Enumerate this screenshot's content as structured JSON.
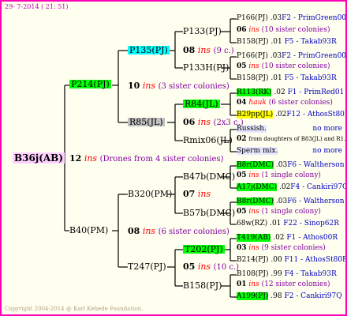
{
  "header_date": "29-  7-2014 ( 21: 51)",
  "footer": "Copyright 2004-2014 @ Karl Kehede Foundation.",
  "root": {
    "name": "B36j(AB)",
    "gen": "12",
    "ins": "ins",
    "note": "(Drones from 4 sister colonies)"
  },
  "sire_side": {
    "name": "P214(PJ)",
    "gen": "10",
    "ins": "ins",
    "note": "(3 sister colonies)",
    "sire": {
      "name": "P135(PJ)",
      "gen": "08",
      "ins": "ins",
      "note": "(9 c.)",
      "sire": {
        "name": "P133(PJ)",
        "gen": "06",
        "ins": "ins",
        "note": "(10 sister colonies)"
      },
      "dam": {
        "name": "P133H(PJ)",
        "gen": "05",
        "ins": "ins",
        "note": "(10 sister colonies)"
      }
    },
    "dam": {
      "name": "R85(JL)",
      "gen": "06",
      "ins": "ins",
      "note": "(2x3 c.)",
      "sire": {
        "name": "R84(JL)",
        "gen": "04",
        "ins": "hauk",
        "note": "(6 sister colonies)"
      },
      "dam": {
        "name": "Rmix06(JL)",
        "gen": "02",
        "ins": "",
        "note": "from daughters of B83(JL) and R1..."
      }
    }
  },
  "dam_side": {
    "name": "B40(PM)",
    "gen": "08",
    "ins": "ins",
    "note": "(6 sister colonies)",
    "sire": {
      "name": "B320(PM)",
      "gen": "07",
      "ins": "ins",
      "note": "",
      "sire": {
        "name": "B47b(DMC)",
        "gen": "05",
        "ins": "ins",
        "note": "(1 single colony)"
      },
      "dam": {
        "name": "B57b(DMC)",
        "gen": "05",
        "ins": "ins",
        "note": "(1 single colony)"
      }
    },
    "dam": {
      "name": "T247(PJ)",
      "gen": "05",
      "ins": "ins",
      "note": "(10 c.)",
      "sire": {
        "name": "T202(PJ)",
        "gen": "03",
        "ins": "ins",
        "note": "(9 sister colonies)"
      },
      "dam": {
        "name": "B158(PJ)",
        "gen": "01",
        "ins": "ins",
        "note": "(12 sister colonies)"
      }
    }
  },
  "col4": [
    {
      "a": "P166(PJ)",
      "b": ".03",
      "c": "F2 - PrimGreen00"
    },
    {
      "a": "B158(PJ)",
      "b": ".01",
      "c": "F5 - Takab93R"
    },
    {
      "a": "P166(PJ)",
      "b": ".03",
      "c": "F2 - PrimGreen00"
    },
    {
      "a": "B158(PJ)",
      "b": ".01",
      "c": "F5 - Takab93R"
    },
    {
      "a": "R113(RK)",
      "b": ".02",
      "c": "F1 - PrimRed01"
    },
    {
      "a": "B29pp(JL)",
      "b": ".02",
      "c": "F12 - AthosSt80R"
    },
    {
      "a": "Russish.",
      "b": "",
      "c": "no more"
    },
    {
      "a": "Sperm mix.",
      "b": "",
      "c": "no more"
    },
    {
      "a": "B8r(DMC)",
      "b": ".03",
      "c": "F6 - Waltherson"
    },
    {
      "a": "A17j(DMC)",
      "b": ".02",
      "c": "F4 - Cankiri97Q"
    },
    {
      "a": "B8r(DMC)",
      "b": ".03",
      "c": "F6 - Waltherson"
    },
    {
      "a": "68w(RZ)",
      "b": ".01",
      "c": "F22 - Sinop62R"
    },
    {
      "a": "T419(AB)",
      "b": ".02",
      "c": "F1 - Athos00R"
    },
    {
      "a": "B214(PJ)",
      "b": ".00",
      "c": "F11 - AthosSt80R"
    },
    {
      "a": "B108(PJ)",
      "b": ".99",
      "c": "F4 - Takab93R"
    },
    {
      "a": "A199(PJ)",
      "b": ".98",
      "c": "F2 - Cankiri97Q"
    }
  ]
}
